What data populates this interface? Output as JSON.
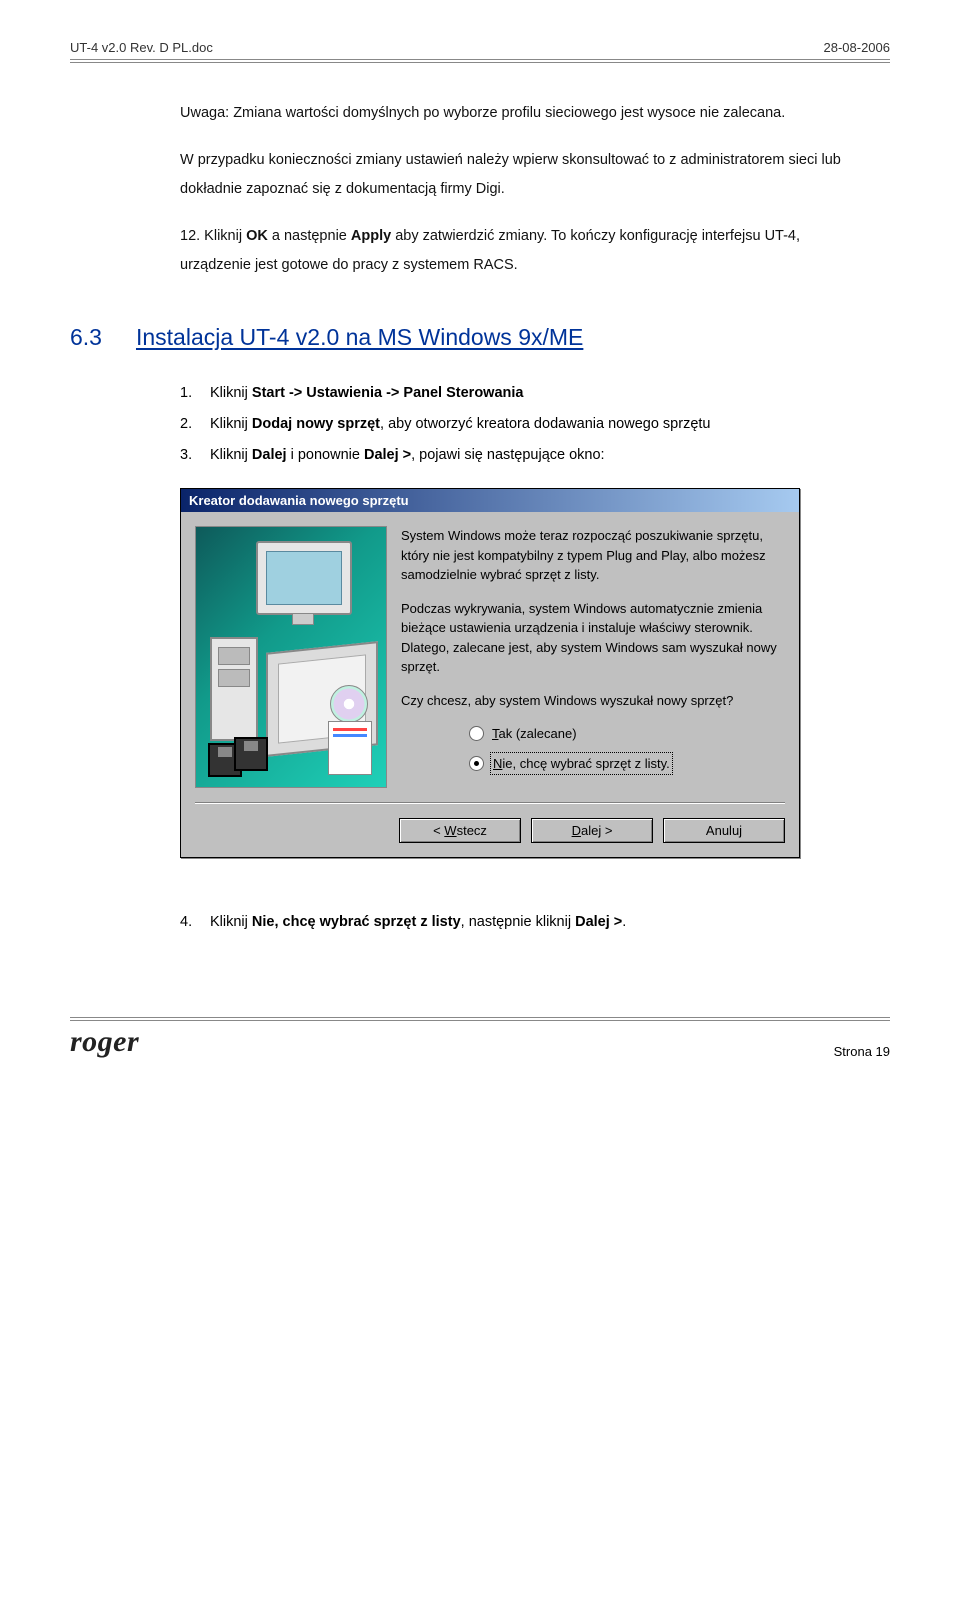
{
  "header": {
    "left": "UT-4 v2.0 Rev. D PL.doc",
    "right": "28-08-2006"
  },
  "paragraphs": {
    "p1": "Uwaga: Zmiana wartości domyślnych po wyborze profilu sieciowego jest wysoce nie zalecana.",
    "p2": "W przypadku konieczności zmiany ustawień należy wpierw skonsultować to z administratorem sieci lub dokładnie zapoznać się z dokumentacją firmy Digi.",
    "p3_pre": "12. Kliknij ",
    "p3_b1": "OK",
    "p3_mid": " a następnie ",
    "p3_b2": "Apply",
    "p3_post": " aby zatwierdzić zmiany. To kończy konfigurację interfejsu UT-4, urządzenie jest gotowe do pracy z systemem RACS."
  },
  "section": {
    "number": "6.3",
    "title": "Instalacja UT-4 v2.0 na MS Windows 9x/ME"
  },
  "list": {
    "i1": {
      "n": "1.",
      "pre": "Kliknij ",
      "b": "Start -> Ustawienia -> Panel Sterowania"
    },
    "i2": {
      "n": "2.",
      "pre": "Kliknij ",
      "b": "Dodaj nowy sprzęt",
      "post": ", aby otworzyć kreatora dodawania nowego sprzętu"
    },
    "i3": {
      "n": "3.",
      "pre": "Kliknij ",
      "b1": "Dalej",
      "mid": " i ponownie ",
      "b2": "Dalej >",
      "post": ", pojawi się następujące okno:"
    }
  },
  "dialog": {
    "title": "Kreator dodawania nowego sprzętu",
    "para1": "System Windows może teraz rozpocząć poszukiwanie sprzętu, który nie jest kompatybilny z typem Plug and Play, albo możesz samodzielnie wybrać sprzęt z listy.",
    "para2": "Podczas wykrywania, system Windows automatycznie zmienia bieżące ustawienia urządzenia i instaluje właściwy sterownik. Dlatego, zalecane jest, aby system Windows sam wyszukał nowy sprzęt.",
    "question": "Czy chcesz, aby system Windows wyszukał nowy sprzęt?",
    "option1_u": "T",
    "option1_rest": "ak (zalecane)",
    "option2_u": "N",
    "option2_rest": "ie, chcę wybrać sprzęt z listy.",
    "btn_back_pre": "< ",
    "btn_back_u": "W",
    "btn_back_rest": "stecz",
    "btn_next_pre": "",
    "btn_next_u": "D",
    "btn_next_rest": "alej >",
    "btn_cancel": "Anuluj"
  },
  "after": {
    "n": "4.",
    "pre": "Kliknij ",
    "b1": "Nie, chcę wybrać sprzęt z listy",
    "mid": ", następnie kliknij ",
    "b2": "Dalej >",
    "post": "."
  },
  "footer": {
    "brand": "roger",
    "page": "Strona 19"
  }
}
